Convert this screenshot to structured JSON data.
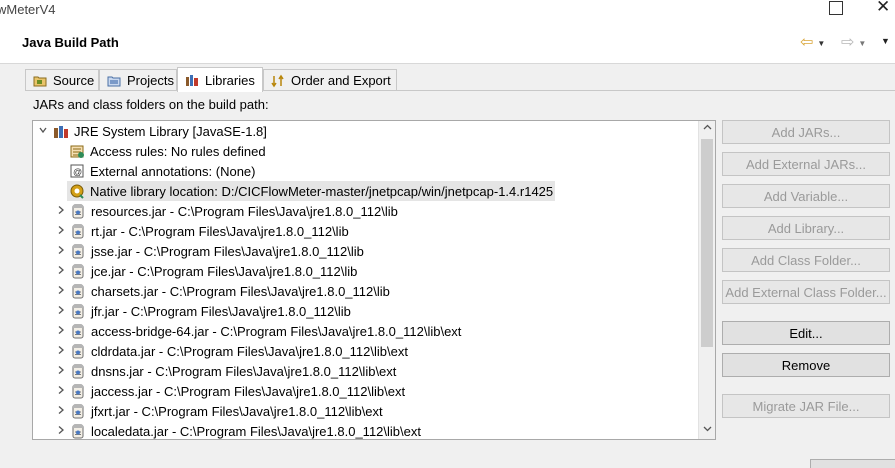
{
  "window": {
    "title": "wMeterV4"
  },
  "header": {
    "title": "Java Build Path"
  },
  "tabs": [
    {
      "label": "Source",
      "icon": "source-folder-icon"
    },
    {
      "label": "Projects",
      "icon": "projects-icon"
    },
    {
      "label": "Libraries",
      "icon": "libraries-icon",
      "active": true
    },
    {
      "label": "Order and Export",
      "icon": "order-export-icon"
    }
  ],
  "libraries": {
    "description": "JARs and class folders on the build path:",
    "tree": {
      "root_label": "JRE System Library [JavaSE-1.8]",
      "attributes": [
        {
          "label": "Access rules: No rules defined",
          "icon": "access-rules-icon"
        },
        {
          "label": "External annotations: (None)",
          "icon": "external-annotations-icon"
        },
        {
          "label": "Native library location: D:/CICFlowMeter-master/jnetpcap/win/jnetpcap-1.4.r1425",
          "icon": "native-library-icon",
          "selected": true
        }
      ],
      "jars": [
        "resources.jar - C:\\Program Files\\Java\\jre1.8.0_112\\lib",
        "rt.jar - C:\\Program Files\\Java\\jre1.8.0_112\\lib",
        "jsse.jar - C:\\Program Files\\Java\\jre1.8.0_112\\lib",
        "jce.jar - C:\\Program Files\\Java\\jre1.8.0_112\\lib",
        "charsets.jar - C:\\Program Files\\Java\\jre1.8.0_112\\lib",
        "jfr.jar - C:\\Program Files\\Java\\jre1.8.0_112\\lib",
        "access-bridge-64.jar - C:\\Program Files\\Java\\jre1.8.0_112\\lib\\ext",
        "cldrdata.jar - C:\\Program Files\\Java\\jre1.8.0_112\\lib\\ext",
        "dnsns.jar - C:\\Program Files\\Java\\jre1.8.0_112\\lib\\ext",
        "jaccess.jar - C:\\Program Files\\Java\\jre1.8.0_112\\lib\\ext",
        "jfxrt.jar - C:\\Program Files\\Java\\jre1.8.0_112\\lib\\ext",
        "localedata.jar - C:\\Program Files\\Java\\jre1.8.0_112\\lib\\ext"
      ]
    },
    "buttons": {
      "add_jars": "Add JARs...",
      "add_external_jars": "Add External JARs...",
      "add_variable": "Add Variable...",
      "add_library": "Add Library...",
      "add_class_folder": "Add Class Folder...",
      "add_external_class_folder": "Add External Class Folder...",
      "edit": "Edit...",
      "remove": "Remove",
      "migrate_jar_file": "Migrate JAR File..."
    }
  },
  "colors": {
    "nav_arrow": "#d9a63a",
    "selection": "#e5e5e5",
    "disabled_text": "#9a9a9a"
  }
}
